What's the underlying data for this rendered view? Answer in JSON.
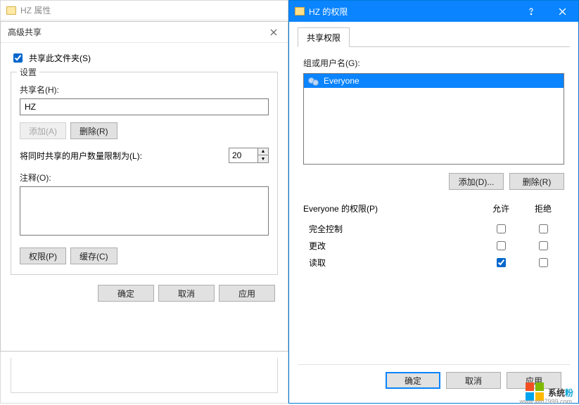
{
  "prop": {
    "title": "HZ 属性",
    "advanced_title": "高级共享",
    "share_checkbox": "共享此文件夹(S)",
    "share_checked": true,
    "settings_legend": "设置",
    "share_name_label": "共享名(H):",
    "share_name_value": "HZ",
    "add_btn": "添加(A)",
    "remove_btn": "删除(R)",
    "limit_label": "将同时共享的用户数量限制为(L):",
    "limit_value": "20",
    "comment_label": "注释(O):",
    "comment_value": "",
    "perm_btn": "权限(P)",
    "cache_btn": "缓存(C)",
    "ok": "确定",
    "cancel": "取消",
    "apply": "应用"
  },
  "perm": {
    "title": "HZ 的权限",
    "tab": "共享权限",
    "group_label": "组或用户名(G):",
    "users": [
      {
        "name": "Everyone",
        "selected": true
      }
    ],
    "add_btn": "添加(D)...",
    "remove_btn": "删除(R)",
    "perm_for": "Everyone 的权限(P)",
    "col_allow": "允许",
    "col_deny": "拒绝",
    "rows": [
      {
        "name": "完全控制",
        "allow": false,
        "deny": false
      },
      {
        "name": "更改",
        "allow": false,
        "deny": false
      },
      {
        "name": "读取",
        "allow": true,
        "deny": false
      }
    ],
    "ok": "确定",
    "cancel": "取消",
    "apply": "应用"
  },
  "watermark": {
    "main_a": "系统",
    "main_b": "粉",
    "sub": "www.win7999.com"
  }
}
